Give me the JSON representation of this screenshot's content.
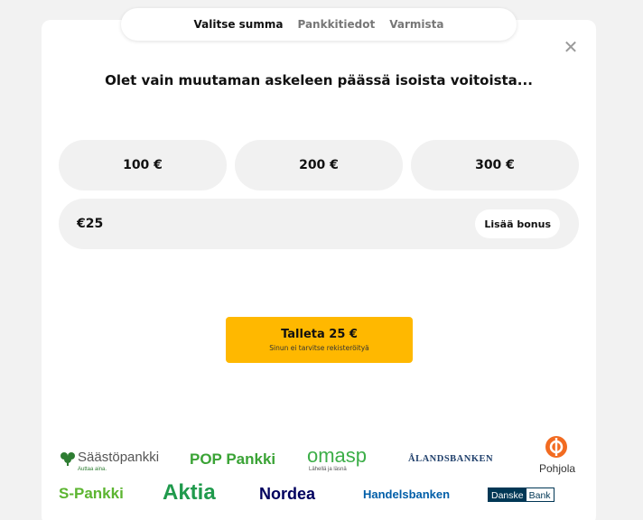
{
  "steps": {
    "step1": "Valitse summa",
    "step2": "Pankkitiedot",
    "step3": "Varmista"
  },
  "close_icon": "close-icon",
  "headline": "Olet vain muutaman askeleen päässä isoista voitoista...",
  "amounts": [
    "100 €",
    "200 €",
    "300 €"
  ],
  "amount_input": {
    "value": "€25"
  },
  "bonus_button": "Lisää bonus",
  "deposit_button": {
    "label": "Talleta 25 €",
    "sub": "Sinun ei tarvitse rekisteröityä"
  },
  "banks": {
    "saastopankki": {
      "name": "Säästöpankki",
      "tagline": "Auttaa aina."
    },
    "poppankki": {
      "name": "POP Pankki"
    },
    "omasp": {
      "name": "omasp",
      "tagline": "Lähellä ja läsnä"
    },
    "alandsbanken": {
      "name": "ÅLANDSBANKEN"
    },
    "pohjola": {
      "name": "Pohjola"
    },
    "spankki": {
      "name": "S-Pankki"
    },
    "aktia": {
      "name": "Aktia"
    },
    "nordea": {
      "name": "Nordea"
    },
    "handelsbanken": {
      "name": "Handelsbanken"
    },
    "danske": {
      "name_part1": "Danske",
      "name_part2": "Bank"
    }
  },
  "colors": {
    "accent": "#ffb800",
    "saastopankki": "#2e7d32",
    "poppankki": "#3aa335",
    "omasp": "#3cae48",
    "alandsbanken": "#1f3f6b",
    "pohjola": "#f26b21",
    "spankki": "#5cb531",
    "aktia": "#1f9a4c",
    "nordea": "#00005e",
    "handelsbanken": "#005ea8",
    "danske": "#003755"
  }
}
